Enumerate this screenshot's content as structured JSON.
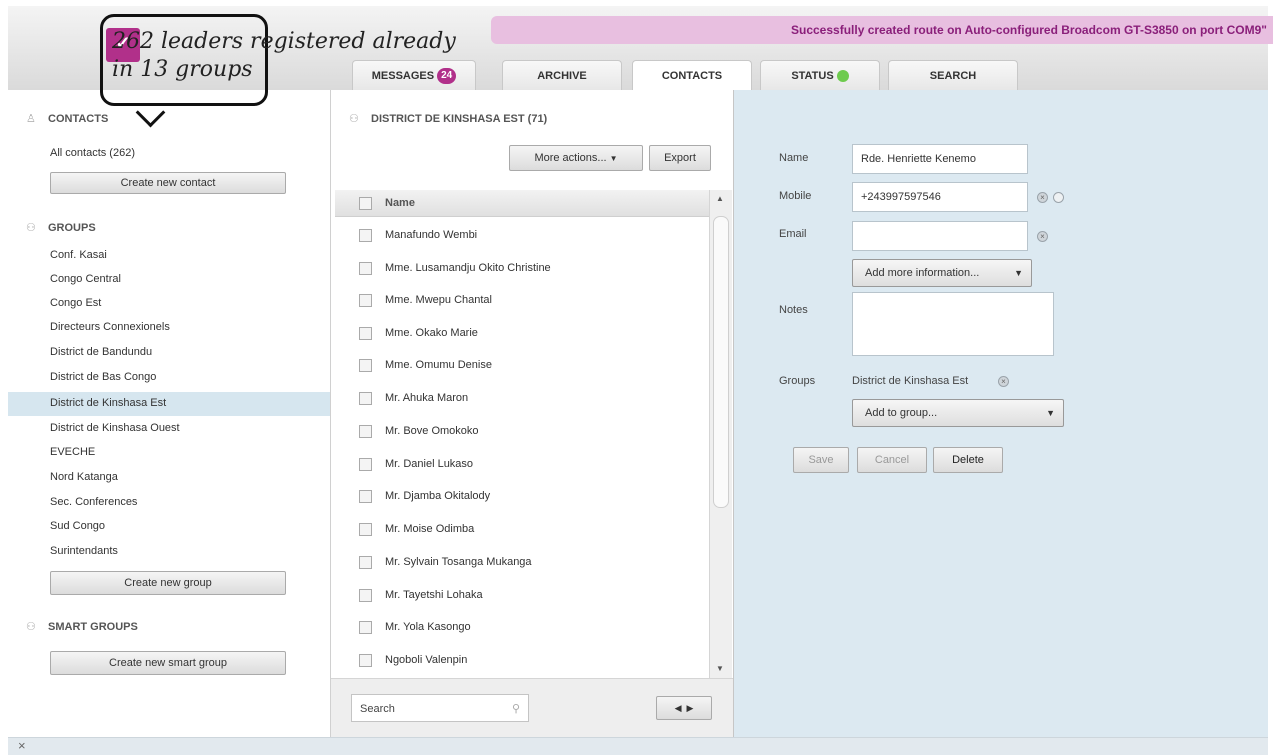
{
  "notification": "Successfully created route on Auto-configured Broadcom GT-S3850 on port COM9\"",
  "annotation": {
    "line1": "262 leaders registered already",
    "line2": "in 13 groups"
  },
  "tabs": {
    "messages": "MESSAGES",
    "messages_badge": "24",
    "archive": "ARCHIVE",
    "contacts": "CONTACTS",
    "status": "STATUS",
    "search": "SEARCH"
  },
  "sidebar": {
    "contacts_title": "CONTACTS",
    "all_contacts": "All contacts (262)",
    "create_contact": "Create new contact",
    "groups_title": "GROUPS",
    "groups": [
      "Conf. Kasai",
      "Congo Central",
      "Congo Est",
      "Directeurs Connexionels",
      "District de Bandundu",
      "District de Bas Congo",
      "District de Kinshasa Est",
      "District de Kinshasa Ouest",
      "EVECHE",
      "Nord Katanga",
      "Sec. Conferences",
      "Sud Congo",
      "Surintendants"
    ],
    "selected_group": "District de Kinshasa Est",
    "create_group": "Create new group",
    "smart_title": "SMART GROUPS",
    "create_smart": "Create new smart group"
  },
  "group_panel": {
    "title": "DISTRICT DE KINSHASA EST (71)",
    "more_actions": "More actions...",
    "export": "Export",
    "column_name": "Name",
    "contacts": [
      "Manafundo Wembi",
      "Mme. Lusamandju Okito Christine",
      "Mme. Mwepu Chantal",
      "Mme. Okako Marie",
      "Mme. Omumu Denise",
      "Mr. Ahuka Maron",
      "Mr. Bove Omokoko",
      "Mr. Daniel Lukaso",
      "Mr. Djamba Okitalody",
      "Mr. Moise Odimba",
      "Mr. Sylvain Tosanga Mukanga",
      "Mr. Tayetshi Lohaka",
      "Mr. Yola Kasongo",
      "Ngoboli Valenpin"
    ],
    "search_placeholder": "Search"
  },
  "contact_form": {
    "name_label": "Name",
    "name_value": "Rde. Henriette Kenemo",
    "mobile_label": "Mobile",
    "mobile_value": "+243997597546",
    "email_label": "Email",
    "email_value": "",
    "add_info": "Add more information...",
    "notes_label": "Notes",
    "notes_value": "",
    "groups_label": "Groups",
    "group_value": "District de Kinshasa Est",
    "add_to_group": "Add to group...",
    "save": "Save",
    "cancel": "Cancel",
    "delete": "Delete"
  },
  "footer": {
    "close": "×"
  }
}
